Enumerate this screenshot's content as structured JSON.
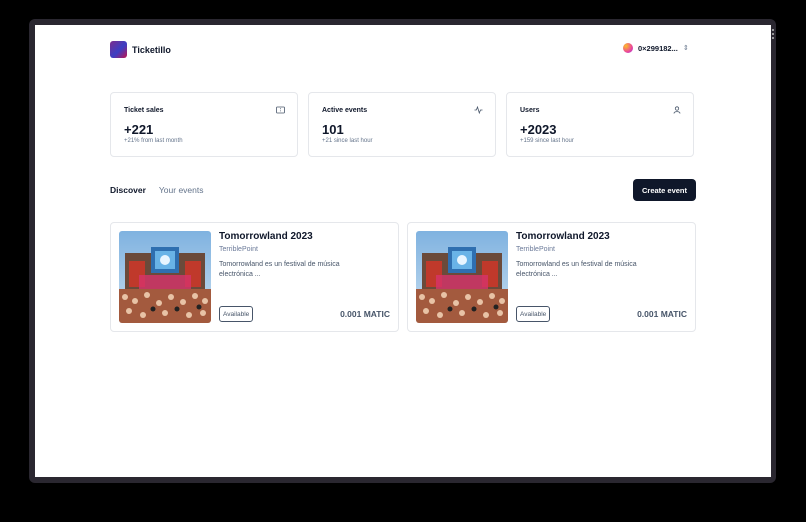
{
  "header": {
    "app_name": "Ticketillo",
    "wallet_address": "0×299182...",
    "wallet_chevron": "⇕"
  },
  "stats": [
    {
      "title": "Ticket sales",
      "value": "+221",
      "sub": "+21% from last month",
      "icon": "ticket-icon"
    },
    {
      "title": "Active events",
      "value": "101",
      "sub": "+21 since last hour",
      "icon": "activity-icon"
    },
    {
      "title": "Users",
      "value": "+2023",
      "sub": "+159 since last hour",
      "icon": "user-icon"
    }
  ],
  "tabs": {
    "discover": "Discover",
    "your_events": "Your events"
  },
  "create_event_label": "Create event",
  "events": [
    {
      "title": "Tomorrowland 2023",
      "organizer": "TerriblePoint",
      "description": "Tomorrowland es un festival de música electrónica ...",
      "status": "Available",
      "price": "0.001 MATIC"
    },
    {
      "title": "Tomorrowland 2023",
      "organizer": "TerriblePoint",
      "description": "Tomorrowland es un festival de música electrónica ...",
      "status": "Available",
      "price": "0.001 MATIC"
    }
  ],
  "colors": {
    "primary": "#0f172a",
    "muted": "#64748b",
    "border": "#e5e7eb"
  }
}
